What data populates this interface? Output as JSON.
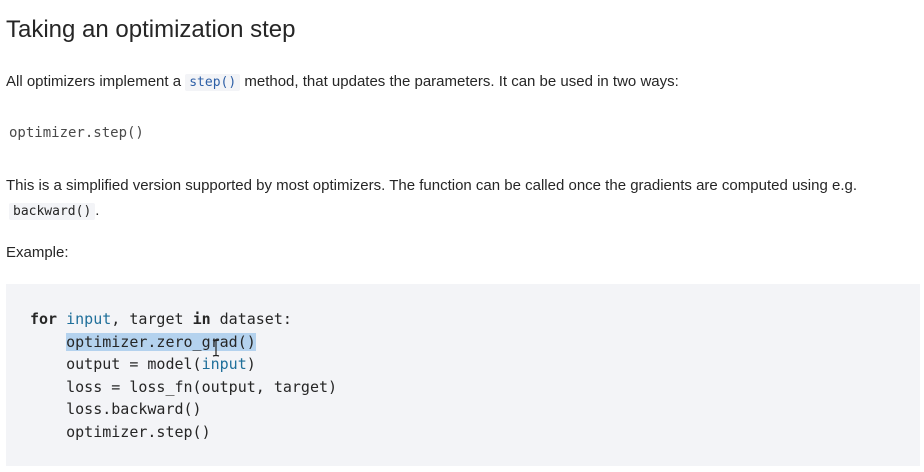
{
  "heading": "Taking an optimization step",
  "para1": {
    "before": "All optimizers implement a ",
    "code": "step()",
    "after": " method, that updates the parameters. It can be used in two ways:"
  },
  "code_single": "optimizer.step()",
  "para2": {
    "line1": "This is a simplified version supported by most optimizers. The function can be called once the gradients are computed using e.g.",
    "code": "backward()",
    "after": "."
  },
  "example_label": "Example:",
  "code_block": {
    "line1": {
      "kw_for": "for",
      "var_input": "input",
      "mid": ", target ",
      "kw_in": "in",
      "end": " dataset:"
    },
    "line2": "    ",
    "line2_selected": "optimizer.zero_grad()",
    "line3": {
      "a": "    output = model(",
      "builtin": "input",
      "b": ")"
    },
    "line4": "    loss = loss_fn(output, target)",
    "line5": "    loss.backward()",
    "line6": "    optimizer.step()"
  }
}
